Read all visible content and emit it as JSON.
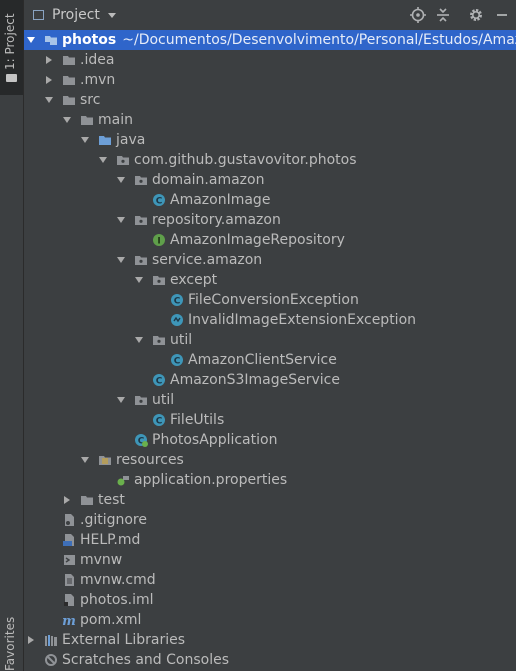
{
  "sidebar": {
    "project_tab": "1: Project",
    "bottom_tab": "Favorites"
  },
  "header": {
    "title": "Project"
  },
  "colors": {
    "selection": "#2f65ca",
    "folder": "#8f9296",
    "source_folder": "#6d9fd7",
    "class_icon": "#3e96b8",
    "interface_icon": "#5f9f4a",
    "resources_folder": "#c9a43a"
  },
  "tree": {
    "root_name": "photos",
    "root_path": "~/Documentos/Desenvolvimento/Personal/Estudos/Amaz",
    "nodes": [
      {
        "label": "photos",
        "depth": 0,
        "arrow": "down",
        "icon": "module-folder"
      },
      {
        "label": ".idea",
        "depth": 1,
        "arrow": "right",
        "icon": "folder"
      },
      {
        "label": ".mvn",
        "depth": 1,
        "arrow": "right",
        "icon": "folder"
      },
      {
        "label": "src",
        "depth": 1,
        "arrow": "down",
        "icon": "folder"
      },
      {
        "label": "main",
        "depth": 2,
        "arrow": "down",
        "icon": "folder"
      },
      {
        "label": "java",
        "depth": 3,
        "arrow": "down",
        "icon": "source-folder"
      },
      {
        "label": "com.github.gustavovitor.photos",
        "depth": 4,
        "arrow": "down",
        "icon": "package"
      },
      {
        "label": "domain.amazon",
        "depth": 5,
        "arrow": "down",
        "icon": "package"
      },
      {
        "label": "AmazonImage",
        "depth": 6,
        "arrow": "none",
        "icon": "class"
      },
      {
        "label": "repository.amazon",
        "depth": 5,
        "arrow": "down",
        "icon": "package"
      },
      {
        "label": "AmazonImageRepository",
        "depth": 6,
        "arrow": "none",
        "icon": "interface"
      },
      {
        "label": "service.amazon",
        "depth": 5,
        "arrow": "down",
        "icon": "package"
      },
      {
        "label": "except",
        "depth": 6,
        "arrow": "down",
        "icon": "package"
      },
      {
        "label": "FileConversionException",
        "depth": 7,
        "arrow": "none",
        "icon": "class"
      },
      {
        "label": "InvalidImageExtensionException",
        "depth": 7,
        "arrow": "none",
        "icon": "exception"
      },
      {
        "label": "util",
        "depth": 6,
        "arrow": "down",
        "icon": "package"
      },
      {
        "label": "AmazonClientService",
        "depth": 7,
        "arrow": "none",
        "icon": "class"
      },
      {
        "label": "AmazonS3ImageService",
        "depth": 6,
        "arrow": "none",
        "icon": "class"
      },
      {
        "label": "util",
        "depth": 5,
        "arrow": "down",
        "icon": "package"
      },
      {
        "label": "FileUtils",
        "depth": 6,
        "arrow": "none",
        "icon": "class"
      },
      {
        "label": "PhotosApplication",
        "depth": 5,
        "arrow": "none",
        "icon": "spring-class"
      },
      {
        "label": "resources",
        "depth": 3,
        "arrow": "down",
        "icon": "resources-folder"
      },
      {
        "label": "application.properties",
        "depth": 4,
        "arrow": "none",
        "icon": "properties"
      },
      {
        "label": "test",
        "depth": 2,
        "arrow": "right",
        "icon": "folder"
      },
      {
        "label": ".gitignore",
        "depth": 1,
        "arrow": "none",
        "icon": "gitignore"
      },
      {
        "label": "HELP.md",
        "depth": 1,
        "arrow": "none",
        "icon": "markdown"
      },
      {
        "label": "mvnw",
        "depth": 1,
        "arrow": "none",
        "icon": "shell"
      },
      {
        "label": "mvnw.cmd",
        "depth": 1,
        "arrow": "none",
        "icon": "text-file"
      },
      {
        "label": "photos.iml",
        "depth": 1,
        "arrow": "none",
        "icon": "iml-file"
      },
      {
        "label": "pom.xml",
        "depth": 1,
        "arrow": "none",
        "icon": "maven"
      },
      {
        "label": "External Libraries",
        "depth": 0,
        "arrow": "right",
        "icon": "libraries"
      },
      {
        "label": "Scratches and Consoles",
        "depth": 0,
        "arrow": "none",
        "icon": "scratches"
      }
    ]
  }
}
